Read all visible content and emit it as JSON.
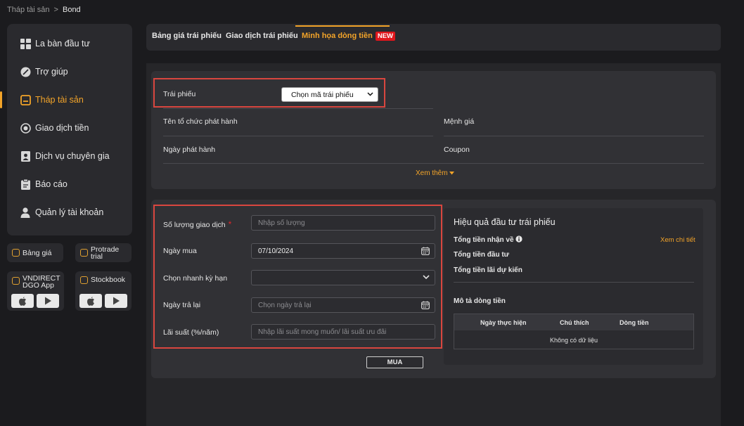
{
  "breadcrumb": {
    "parent": "Tháp tài sản",
    "separator": ">",
    "current": "Bond"
  },
  "sidebar": {
    "items": [
      {
        "label": "La bàn đầu tư",
        "icon": "compass-grid-icon"
      },
      {
        "label": "Trợ giúp",
        "icon": "help-icon"
      },
      {
        "label": "Tháp tài sản",
        "icon": "asset-tower-icon",
        "active": true
      },
      {
        "label": "Giao dịch tiền",
        "icon": "money-transfer-icon"
      },
      {
        "label": "Dịch vụ chuyên gia",
        "icon": "expert-icon"
      },
      {
        "label": "Báo cáo",
        "icon": "report-icon"
      },
      {
        "label": "Quản lý tài khoản",
        "icon": "user-icon"
      }
    ]
  },
  "apps": {
    "bang_gia": "Bảng giá",
    "protrade": "Protrade trial",
    "dgo_line1": "VNDIRECT",
    "dgo_line2": "DGO App",
    "stockbook": "Stockbook"
  },
  "tabs": [
    {
      "label": "Bảng giá trái phiếu"
    },
    {
      "label": "Giao dịch trái phiếu"
    },
    {
      "label": "Minh họa dòng tiền",
      "badge": "NEW",
      "active": true
    }
  ],
  "bond_info": {
    "bond_label": "Trái phiếu",
    "bond_select": "Chọn mã trái phiếu",
    "issuer_label": "Tên tổ chức phát hành",
    "par_label": "Mệnh giá",
    "issue_date_label": "Ngày phát hành",
    "coupon_label": "Coupon",
    "see_more": "Xem thêm"
  },
  "form": {
    "quantity_label": "Số lượng giao dịch",
    "quantity_required": "*",
    "quantity_placeholder": "Nhập số lượng",
    "buy_date_label": "Ngày mua",
    "buy_date_value": "07/10/2024",
    "term_label": "Chọn nhanh kỳ hạn",
    "sell_date_label": "Ngày trả lại",
    "sell_date_placeholder": "Chọn ngày trả lại",
    "rate_label": "Lãi suất (%/năm)",
    "rate_placeholder": "Nhập lãi suất mong muốn/ lãi suất ưu đãi",
    "buy_button": "MUA"
  },
  "performance": {
    "title": "Hiệu quả đầu tư trái phiếu",
    "total_received": "Tổng tiền nhận về",
    "view_detail": "Xem chi tiết",
    "total_invested": "Tổng tiền đầu tư",
    "total_interest": "Tổng tiền lãi dự kiến",
    "cashflow_title": "Mô tả dòng tiền",
    "columns": [
      "Ngày thực hiện",
      "Chú thích",
      "Dòng tiền"
    ],
    "empty": "Không có dữ liệu"
  },
  "colors": {
    "accent": "#f3a429",
    "highlight_border": "#d9463f",
    "badge": "#e0161c"
  }
}
